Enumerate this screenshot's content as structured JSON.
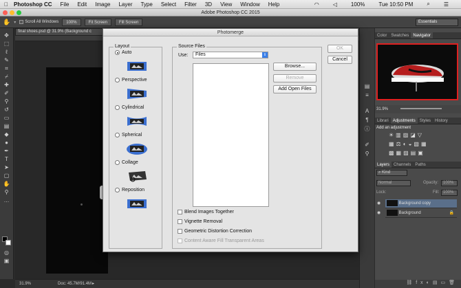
{
  "menubar": {
    "app": "Photoshop CC",
    "items": [
      "File",
      "Edit",
      "Image",
      "Layer",
      "Type",
      "Select",
      "Filter",
      "3D",
      "View",
      "Window",
      "Help"
    ],
    "battery": "100%",
    "clock": "Tue 10:50 PM"
  },
  "window_title": "Adobe Photoshop CC 2015",
  "options_bar": {
    "scroll_all": "Scroll All Windows",
    "zoom": "100%",
    "fit": "Fit Screen",
    "fill": "Fill Screen",
    "workspace": "Essentials"
  },
  "document_tab": "final shoes.psd @ 31.9% (Background c",
  "status": {
    "zoom": "31.9%",
    "doc": "Doc: 45.7M/91.4M"
  },
  "dialog": {
    "title": "Photomerge",
    "layout_label": "Layout",
    "layouts": [
      "Auto",
      "Perspective",
      "Cylindrical",
      "Spherical",
      "Collage",
      "Reposition"
    ],
    "source_label": "Source Files",
    "use_label": "Use:",
    "use_value": "Files",
    "browse": "Browse...",
    "remove": "Remove",
    "add_open": "Add Open Files",
    "ok": "OK",
    "cancel": "Cancel",
    "options": [
      "Blend Images Together",
      "Vignette Removal",
      "Geometric Distortion Correction",
      "Content Aware Fill Transparent Areas"
    ]
  },
  "panels": {
    "top_tabs": [
      "Color",
      "Swatches",
      "Navigator"
    ],
    "nav_zoom": "31.9%",
    "adj_tabs": [
      "Librari",
      "Adjustments",
      "Styles",
      "History"
    ],
    "add_adjustment": "Add an adjustment",
    "layer_tabs": [
      "Layers",
      "Channels",
      "Paths"
    ],
    "kind": "Kind",
    "blend": "Normal",
    "opacity_label": "Opacity:",
    "opacity": "100%",
    "lock_label": "Lock:",
    "fill_label": "Fill:",
    "fill": "100%",
    "layers": [
      "Background copy",
      "Background"
    ]
  }
}
